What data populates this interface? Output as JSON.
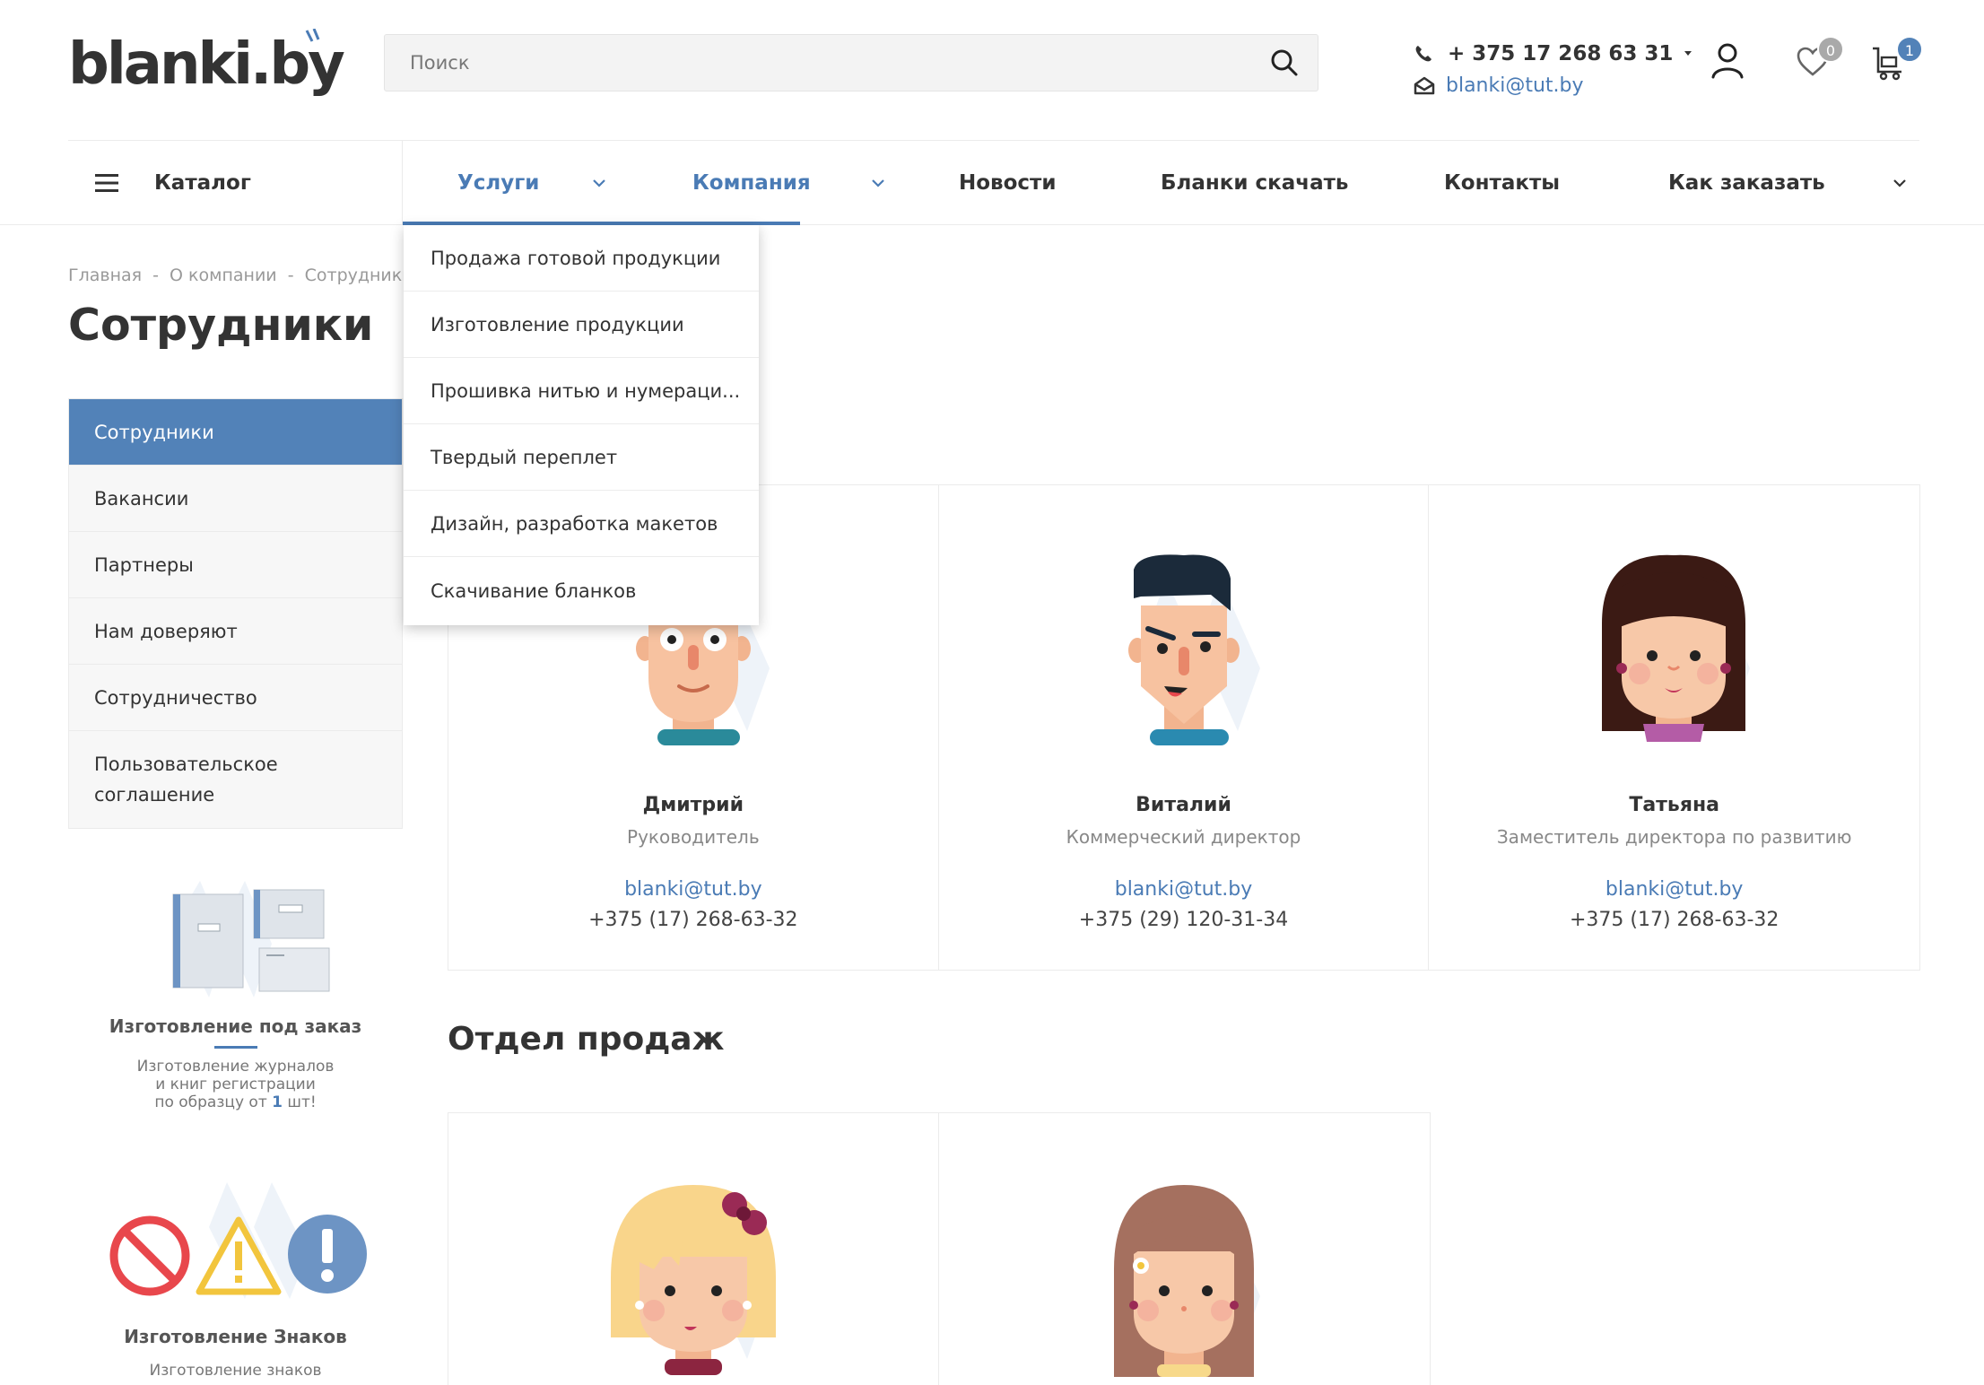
{
  "header": {
    "logo_text": "blanki",
    "logo_domain": ".by",
    "search_placeholder": "Поиск",
    "phone": "+ 375 17 268 63 31",
    "email": "blanki@tut.by",
    "favorites_count": "0",
    "cart_count": "1"
  },
  "nav": {
    "catalog": "Каталог",
    "services": "Услуги",
    "company": "Компания",
    "news": "Новости",
    "download": "Бланки скачать",
    "contacts": "Контакты",
    "howto": "Как заказать"
  },
  "dropdown": [
    "Продажа готовой продукции",
    "Изготовление продукции",
    "Прошивка нитью и нумераци...",
    "Твердый переплет",
    "Дизайн, разработка макетов",
    "Скачивание бланков"
  ],
  "breadcrumb": {
    "home": "Главная",
    "about": "О компании",
    "current": "Сотрудники",
    "sep": "-"
  },
  "page_title": "Сотрудники",
  "side_menu": [
    "Сотрудники",
    "Вакансии",
    "Партнеры",
    "Нам доверяют",
    "Сотрудничество",
    "Пользовательское соглашение"
  ],
  "promo1": {
    "title": "Изготовление под заказ",
    "line1": "Изготовление журналов",
    "line2": "и книг регистрации",
    "line3_a": "по образцу от",
    "line3_b": "1",
    "line3_c": "шт!"
  },
  "promo2": {
    "title": "Изготовление Знаков",
    "sub": "Изготовление знаков"
  },
  "employees": [
    {
      "name": "Дмитрий",
      "role": "Руководитель",
      "email": "blanki@tut.by",
      "phone": "+375 (17) 268-63-32"
    },
    {
      "name": "Виталий",
      "role": "Коммерческий директор",
      "email": "blanki@tut.by",
      "phone": "+375 (29) 120-31-34"
    },
    {
      "name": "Татьяна",
      "role": "Заместитель директора по развитию",
      "email": "blanki@tut.by",
      "phone": "+375 (17) 268-63-32"
    }
  ],
  "sales_title": "Отдел продаж",
  "colors": {
    "accent": "#4a7bb5",
    "active_menu": "#5282b8",
    "badge_gray": "#a9a9a9"
  },
  "icons": [
    "search-icon",
    "phone-icon",
    "mail-icon",
    "user-icon",
    "heart-icon",
    "cart-icon",
    "burger-icon",
    "chevron-down-icon"
  ]
}
